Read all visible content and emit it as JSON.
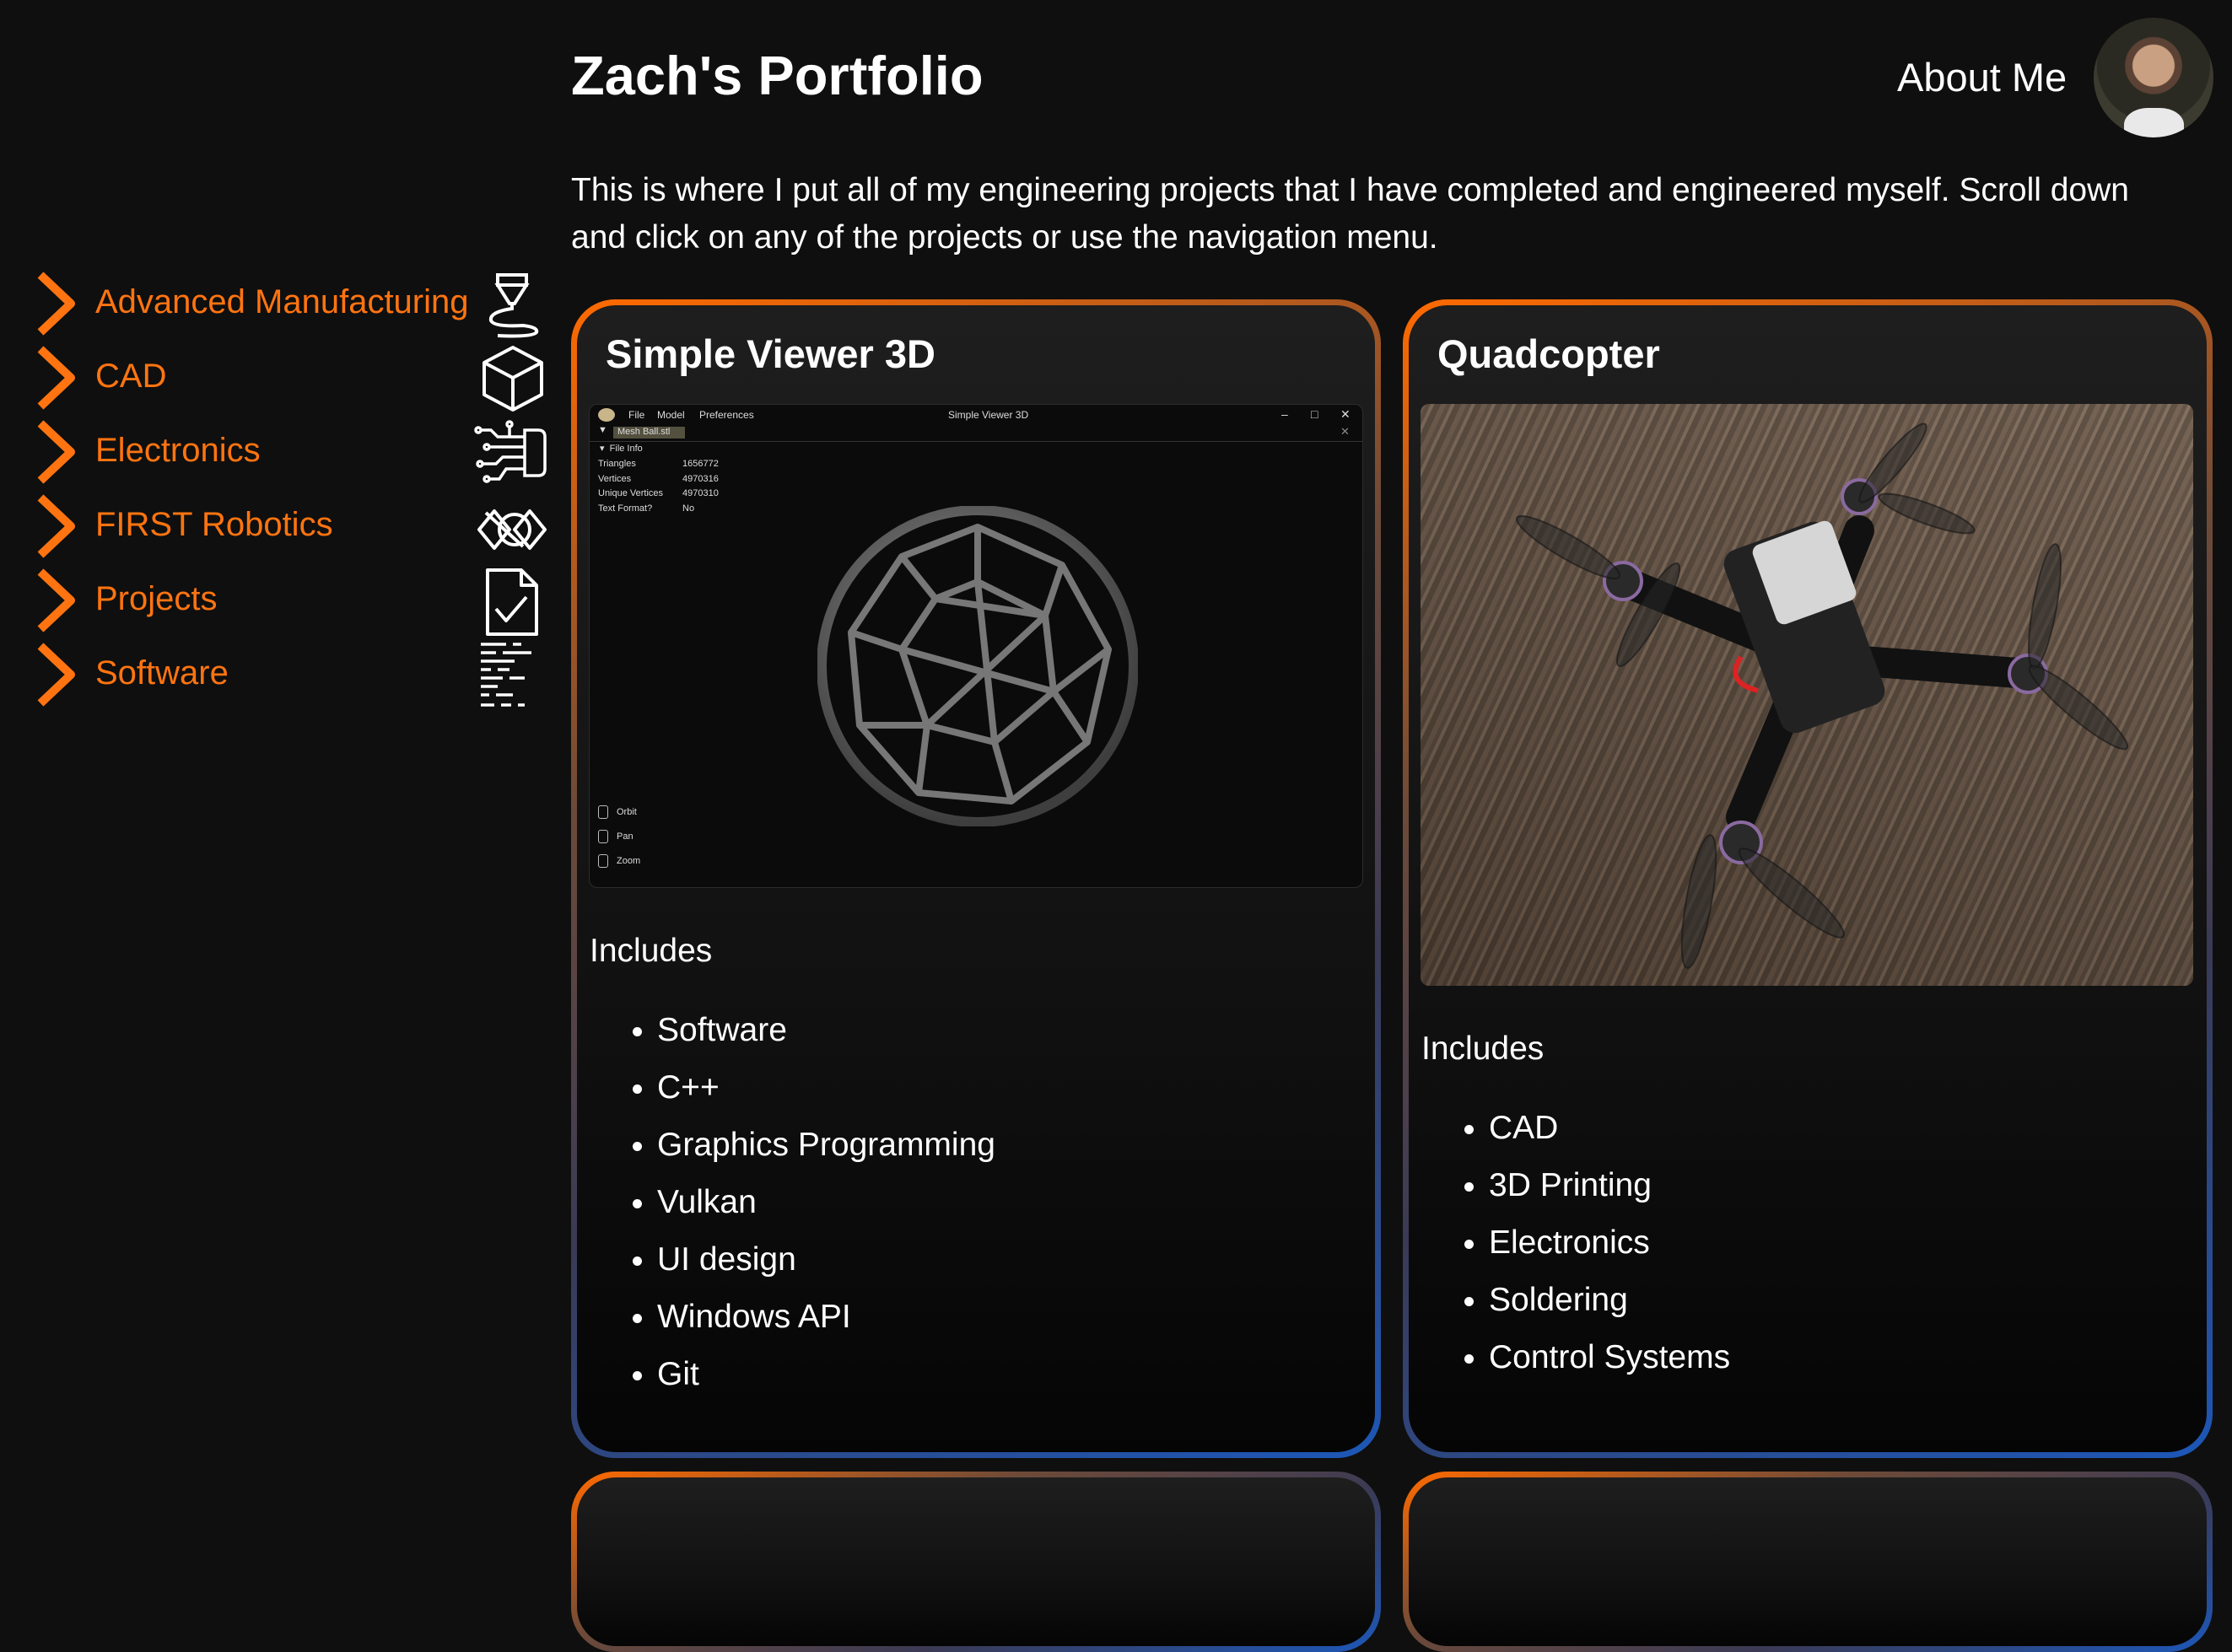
{
  "header": {
    "title": "Zach's Portfolio",
    "about_label": "About Me",
    "intro": "This is where I put all of my engineering projects that I have completed and engineered myself. Scroll down and click on any of the projects or use the navigation menu."
  },
  "sidebar": {
    "items": [
      {
        "label": "Advanced Manufacturing",
        "icon": "3d-printer-nozzle-icon"
      },
      {
        "label": "CAD",
        "icon": "cube-icon"
      },
      {
        "label": "Electronics",
        "icon": "circuit-icon"
      },
      {
        "label": "FIRST Robotics",
        "icon": "first-logo-icon"
      },
      {
        "label": "Projects",
        "icon": "checklist-document-icon"
      },
      {
        "label": "Software",
        "icon": "code-lines-icon"
      }
    ]
  },
  "cards": [
    {
      "title": "Simple Viewer 3D",
      "includes_label": "Includes",
      "tags": [
        "Software",
        "C++",
        "Graphics Programming",
        "Vulkan",
        "UI design",
        "Windows API",
        "Git"
      ],
      "screenshot": {
        "window_title": "Simple Viewer 3D",
        "menus": [
          "File",
          "Model",
          "Preferences"
        ],
        "tab": "Mesh Ball.stl",
        "section": "File Info",
        "rows": [
          {
            "key": "Triangles",
            "value": "1656772"
          },
          {
            "key": "Vertices",
            "value": "4970316"
          },
          {
            "key": "Unique Vertices",
            "value": "4970310"
          },
          {
            "key": "Text Format?",
            "value": "No"
          }
        ],
        "controls": [
          "Orbit",
          "Pan",
          "Zoom"
        ]
      }
    },
    {
      "title": "Quadcopter",
      "includes_label": "Includes",
      "tags": [
        "CAD",
        "3D Printing",
        "Electronics",
        "Soldering",
        "Control Systems"
      ]
    }
  ],
  "colors": {
    "accent": "#ff7410",
    "background": "#0f0f0f",
    "card_border_start": "#ff6a00",
    "card_border_end": "#1d57b8"
  }
}
